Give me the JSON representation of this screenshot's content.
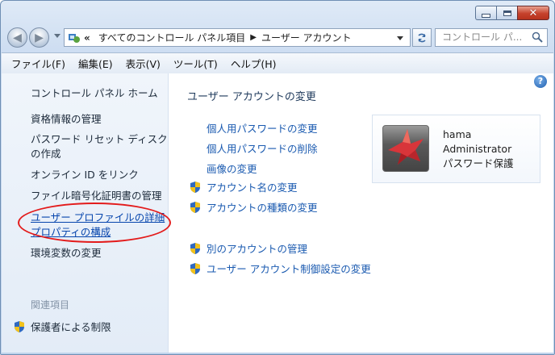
{
  "address": {
    "crumbs": [
      "すべてのコントロール パネル項目",
      "ユーザー アカウント"
    ],
    "overflow": "«",
    "search_placeholder": "コントロール パ..."
  },
  "menu": [
    "ファイル(F)",
    "編集(E)",
    "表示(V)",
    "ツール(T)",
    "ヘルプ(H)"
  ],
  "left_pane": {
    "home": "コントロール パネル ホーム",
    "links": [
      "資格情報の管理",
      "パスワード リセット ディスク",
      "の作成",
      "オンライン ID をリンク",
      "ファイル暗号化証明書の管理",
      "ユーザー プロファイルの詳細",
      "プロパティの構成",
      "環境変数の変更"
    ],
    "related_header": "関連項目",
    "related": "保護者による制限"
  },
  "main": {
    "title": "ユーザー アカウントの変更",
    "tasks_plain": [
      "個人用パスワードの変更",
      "個人用パスワードの削除",
      "画像の変更"
    ],
    "tasks_shield": [
      "アカウント名の変更",
      "アカウントの種類の変更"
    ],
    "tasks_other": [
      "別のアカウントの管理",
      "ユーザー アカウント制御設定の変更"
    ]
  },
  "user": {
    "name": "hama",
    "role": "Administrator",
    "status": "パスワード保護"
  },
  "colors": {
    "link": "#1a5ab0",
    "highlight_ring": "#e31b1b"
  },
  "icons": [
    "back-arrow-icon",
    "forward-arrow-icon",
    "control-panel-icon",
    "refresh-icon",
    "search-icon",
    "help-icon",
    "uac-shield-icon"
  ]
}
